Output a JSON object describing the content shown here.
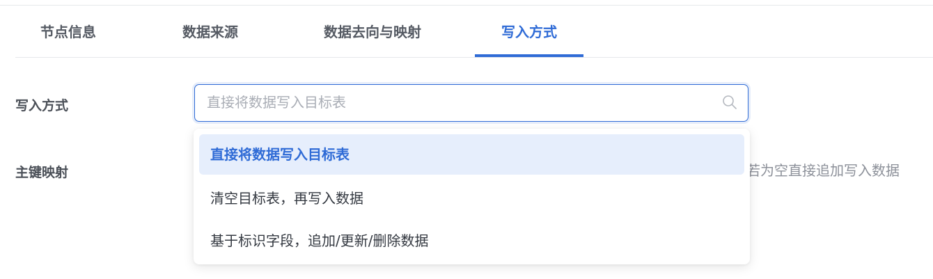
{
  "tabs": [
    {
      "label": "节点信息"
    },
    {
      "label": "数据来源"
    },
    {
      "label": "数据去向与映射"
    },
    {
      "label": "写入方式",
      "active": true
    }
  ],
  "form": {
    "write_mode_label": "写入方式",
    "primary_key_label": "主键映射",
    "select_placeholder": "直接将数据写入目标表",
    "search_icon": "search-icon",
    "hint_partial": "若为空直接追加写入数据"
  },
  "dropdown": {
    "options": [
      {
        "label": "直接将数据写入目标表",
        "selected": true
      },
      {
        "label": "清空目标表，再写入数据"
      },
      {
        "label": "基于标识字段，追加/更新/删除数据"
      }
    ]
  },
  "colors": {
    "accent": "#2f6bd6",
    "selected_bg": "#e6eefc",
    "placeholder": "#a9adb5"
  }
}
